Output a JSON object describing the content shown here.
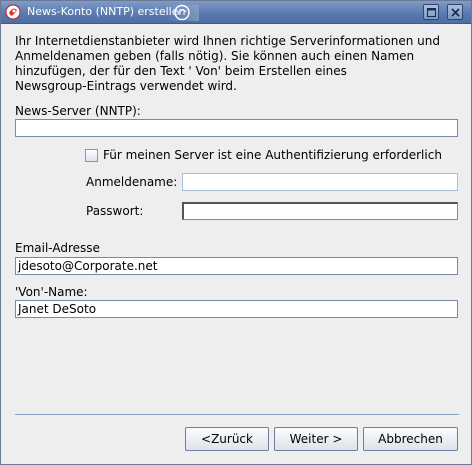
{
  "window": {
    "title": "News-Konto (NNTP) erstellen"
  },
  "intro_lines": [
    "Ihr Internetdienstanbieter wird Ihnen richtige Serverinformationen und",
    "Anmeldenamen geben (falls nötig). Sie können auch einen Namen",
    "hinzufügen, der für den Text ' Von' beim Erstellen eines",
    "Newsgroup-Eintrags verwendet wird."
  ],
  "form": {
    "server_label": "News-Server (NNTP):",
    "server_value": "",
    "auth_checkbox_label": "Für meinen Server ist eine Authentifizierung erforderlich",
    "auth_checked": false,
    "login_label": "Anmeldename:",
    "login_value": "",
    "password_label": "Passwort:",
    "password_value": "",
    "email_label": "Email-Adresse",
    "email_value": "jdesoto@Corporate.net",
    "from_label": "'Von'-Name:",
    "from_value": "Janet DeSoto"
  },
  "buttons": {
    "back": "<Zurück",
    "next": "Weiter >",
    "cancel": "Abbrechen"
  },
  "colors": {
    "titlebar": "#5b7bb0",
    "window_bg": "#eeeeee"
  }
}
